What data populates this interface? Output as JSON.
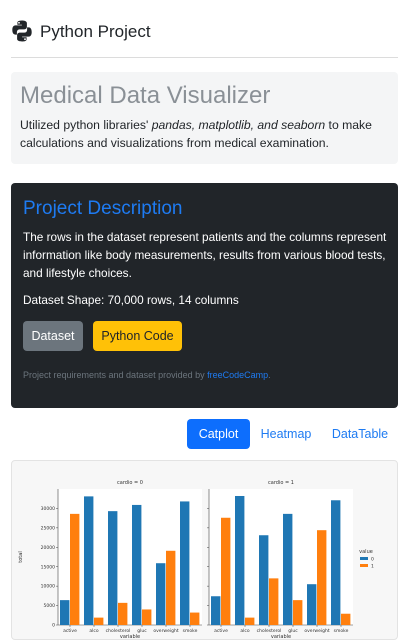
{
  "header": {
    "title": "Python Project",
    "icon": "python-logo-icon"
  },
  "jumbotron": {
    "title": "Medical Data Visualizer",
    "desc_prefix": "Utilized python libraries' ",
    "desc_libs": "pandas, matplotlib, and seaborn",
    "desc_suffix": " to make calculations and visualizations from medical examination."
  },
  "description": {
    "title": "Project Description",
    "text": "The rows in the dataset represent patients and the columns represent information like body measurements, results from various blood tests, and lifestyle choices.",
    "shape": "Dataset Shape: 70,000 rows, 14 columns",
    "dataset_button": "Dataset",
    "code_button": "Python Code",
    "credit_prefix": "Project requirements and dataset provided by ",
    "credit_link": "freeCodeCamp",
    "credit_suffix": "."
  },
  "tabs": [
    {
      "label": "Catplot",
      "active": true
    },
    {
      "label": "Heatmap",
      "active": false
    },
    {
      "label": "DataTable",
      "active": false
    }
  ],
  "colors": {
    "series0": "#1f77b4",
    "series1": "#ff7f0e",
    "accent": "#0d6efd"
  },
  "chart_data": {
    "type": "bar",
    "categories": [
      "active",
      "alco",
      "cholesterol",
      "gluc",
      "overweight",
      "smoke"
    ],
    "ylabel": "total",
    "xlabel": "variable",
    "ylim": [
      0,
      35000
    ],
    "yticks": [
      0,
      5000,
      10000,
      15000,
      20000,
      25000,
      30000
    ],
    "legend": {
      "title": "value",
      "entries": [
        "0",
        "1"
      ],
      "placement": "right"
    },
    "panels": [
      {
        "title": "cardio = 0",
        "series": [
          {
            "name": "0",
            "values": [
              6400,
              33100,
              29300,
              30900,
              15900,
              31800
            ]
          },
          {
            "name": "1",
            "values": [
              28600,
              1900,
              5700,
              4000,
              19100,
              3200
            ]
          }
        ]
      },
      {
        "title": "cardio = 1",
        "series": [
          {
            "name": "0",
            "values": [
              7400,
              33200,
              23100,
              28600,
              10500,
              32100
            ]
          },
          {
            "name": "1",
            "values": [
              27600,
              1900,
              12000,
              6400,
              24400,
              2900
            ]
          }
        ]
      }
    ]
  }
}
